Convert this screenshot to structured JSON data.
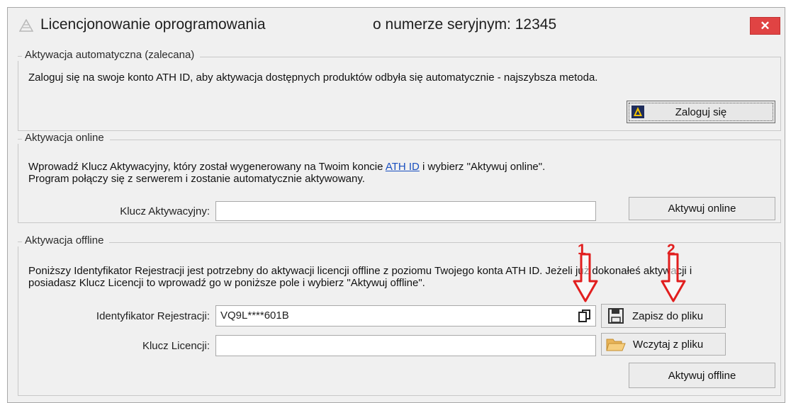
{
  "window": {
    "title": "Licencjonowanie oprogramowania",
    "serial_text": "o numerze seryjnym: 12345",
    "close_icon": "close-icon"
  },
  "auto": {
    "title": "Aktywacja automatyczna (zalecana)",
    "description": "Zaloguj się na swoje konto ATH ID, aby aktywacja dostępnych produktów odbyła się automatycznie - najszybsza metoda.",
    "login_button": "Zaloguj się"
  },
  "online": {
    "title": "Aktywacja online",
    "desc_part1": "Wprowadź Klucz Aktywacyjny, który został wygenerowany na Twoim koncie ",
    "desc_link": "ATH ID",
    "desc_part2": " i wybierz \"Aktywuj online\".",
    "desc_line2": "Program połączy się z serwerem i zostanie automatycznie aktywowany.",
    "key_label": "Klucz Aktywacyjny:",
    "key_value": "",
    "activate_button": "Aktywuj online"
  },
  "offline": {
    "title": "Aktywacja offline",
    "desc_line1": "Poniższy Identyfikator Rejestracji jest potrzebny do aktywacji licencji offline z poziomu Twojego konta ATH ID. Jeżeli już dokonałeś aktywacji i",
    "desc_line2": "posiadasz Klucz Licencji to wprowadź go w poniższe pole i wybierz \"Aktywuj offline\".",
    "reg_id_label": "Identyfikator Rejestracji:",
    "reg_id_value": "VQ9L****601B",
    "save_button": "Zapisz do pliku",
    "license_label": "Klucz Licencji:",
    "license_value": "",
    "load_button": "Wczytaj z pliku",
    "activate_button": "Aktywuj offline"
  },
  "annotations": {
    "marker1": "1",
    "marker2": "2",
    "color": "#e11e1e"
  }
}
